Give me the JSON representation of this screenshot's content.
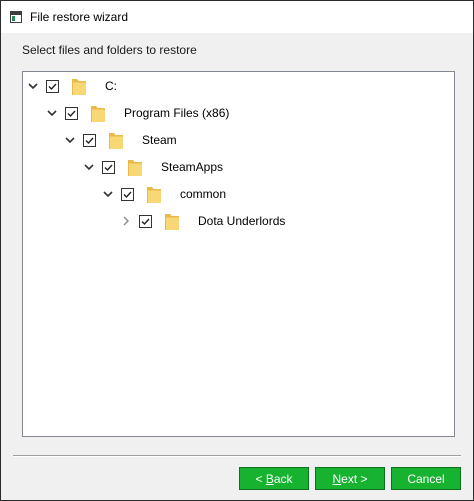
{
  "window": {
    "title": "File restore wizard",
    "app_icon": "window-icon"
  },
  "instruction": "Select files and folders to restore",
  "tree": {
    "nodes": [
      {
        "label": "C:",
        "depth": 0,
        "expanded": true,
        "checked": true,
        "icon": "folder-icon"
      },
      {
        "label": "Program Files (x86)",
        "depth": 1,
        "expanded": true,
        "checked": true,
        "icon": "folder-icon"
      },
      {
        "label": "Steam",
        "depth": 2,
        "expanded": true,
        "checked": true,
        "icon": "folder-icon"
      },
      {
        "label": "SteamApps",
        "depth": 3,
        "expanded": true,
        "checked": true,
        "icon": "folder-icon"
      },
      {
        "label": "common",
        "depth": 4,
        "expanded": true,
        "checked": true,
        "icon": "folder-icon"
      },
      {
        "label": "Dota Underlords",
        "depth": 5,
        "expanded": false,
        "checked": true,
        "icon": "folder-icon"
      }
    ]
  },
  "buttons": {
    "back": {
      "prefix": "< ",
      "mnemonic": "B",
      "rest": "ack"
    },
    "next": {
      "mnemonic": "N",
      "rest": "ext >"
    },
    "cancel": {
      "label": "Cancel"
    }
  },
  "colors": {
    "button_bg": "#17b330",
    "button_text": "#ffffff",
    "folder": "#f5d26b"
  }
}
